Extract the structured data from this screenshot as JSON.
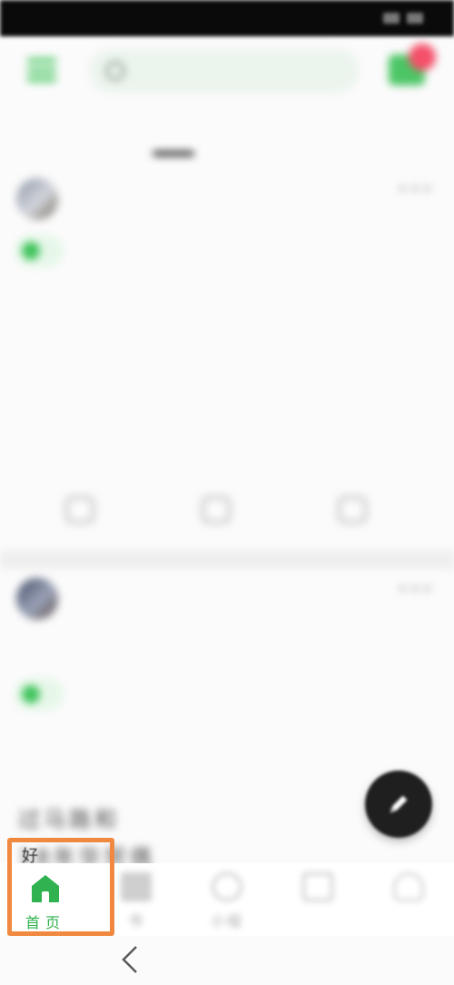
{
  "status_bar": {
    "time": "",
    "indicators": ""
  },
  "top_bar": {
    "search_placeholder": ""
  },
  "tabs": {
    "follow_label": "",
    "recommend_label": ""
  },
  "posts": [
    {
      "username": "",
      "topic": "",
      "lines": [
        "",
        "",
        "",
        "",
        ""
      ],
      "more_label": "",
      "likes": "",
      "comments": "",
      "shares": ""
    },
    {
      "username": "",
      "topic": "",
      "lines": [
        "",
        "",
        "过马路和",
        "18年华贸偶"
      ]
    }
  ],
  "bottom_nav": {
    "home_label": "首页",
    "book_label": "书",
    "circle_label": "小组",
    "market_label": "",
    "me_label": ""
  },
  "fragment_text": "好",
  "colors": {
    "accent_green": "#3fc45b",
    "nav_active_green": "#2fb24f",
    "highlight_orange": "#f0893f",
    "notification_red": "#f4506a",
    "fab_dark": "#1f1f1f"
  },
  "icons": {
    "menu": "menu-icon",
    "search": "search-icon",
    "mail": "mail-icon",
    "more": "more-icon",
    "like": "thumbs-up-icon",
    "comment": "comment-icon",
    "share": "share-icon",
    "compose": "pencil-icon",
    "home": "home-icon",
    "book": "book-icon",
    "circle": "circle-icon",
    "market": "market-icon",
    "me": "profile-icon",
    "back": "back-arrow-icon"
  }
}
